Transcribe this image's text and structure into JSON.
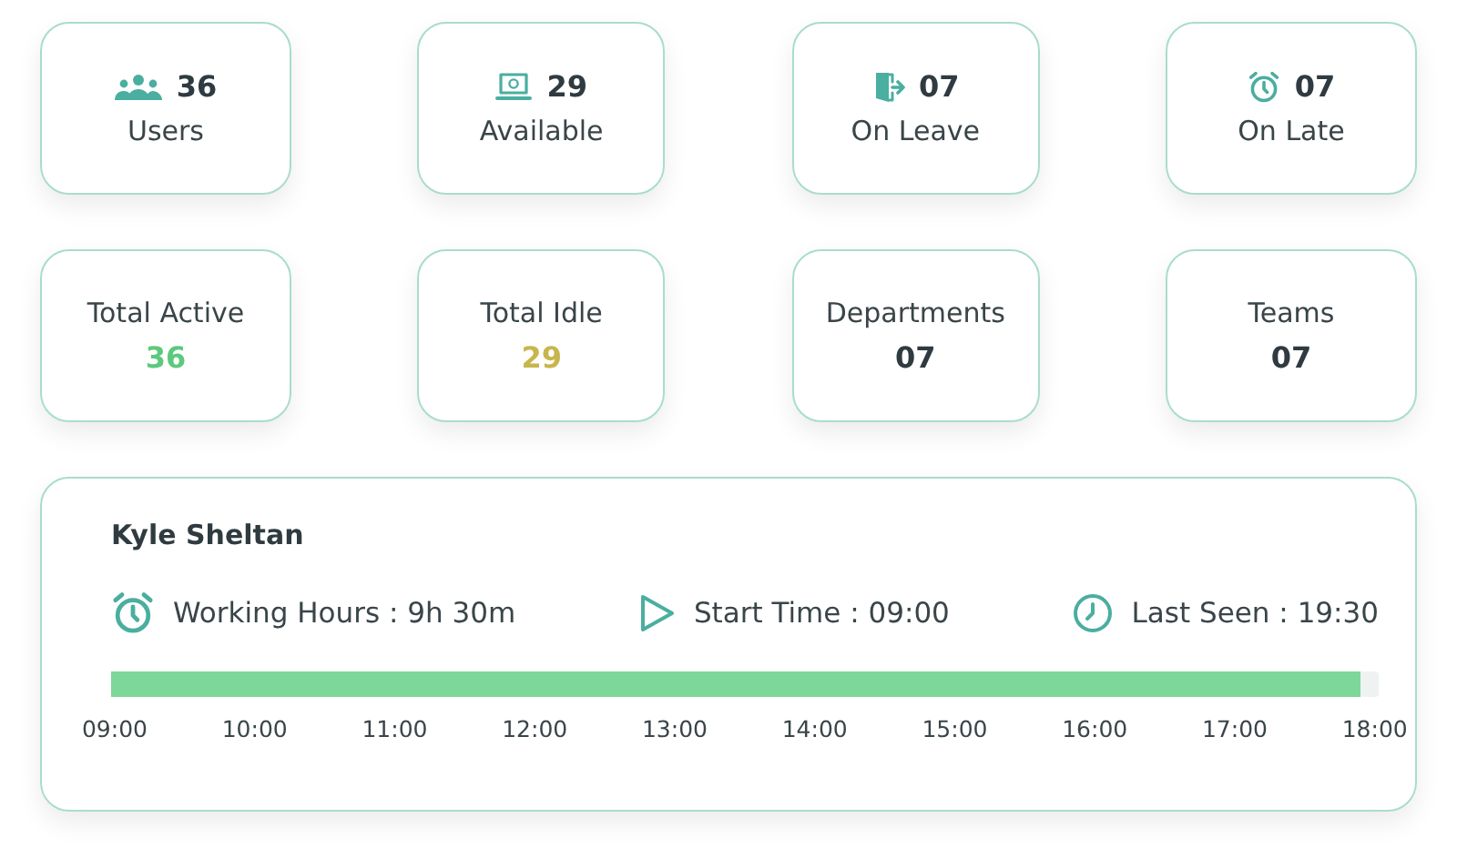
{
  "summary_cards": [
    {
      "kind": "users",
      "value": "36",
      "label": "Users"
    },
    {
      "kind": "laptop",
      "value": "29",
      "label": "Available"
    },
    {
      "kind": "exit",
      "value": "07",
      "label": "On Leave"
    },
    {
      "kind": "alarm",
      "value": "07",
      "label": "On Late"
    }
  ],
  "stat_cards": [
    {
      "label": "Total Active",
      "value": "36",
      "color": "#5cc97c"
    },
    {
      "label": "Total Idle",
      "value": "29",
      "color": "#c8b64c"
    },
    {
      "label": "Departments",
      "value": "07",
      "color": "#2f3b40"
    },
    {
      "label": "Teams",
      "value": "07",
      "color": "#2f3b40"
    }
  ],
  "timeline": {
    "name": "Kyle Sheltan",
    "metrics": [
      {
        "kind": "alarm",
        "text": "Working Hours : 9h 30m"
      },
      {
        "kind": "play",
        "text": "Start Time : 09:00"
      },
      {
        "kind": "clock",
        "text": "Last Seen : 19:30"
      }
    ],
    "level": 0.986,
    "ticks": [
      "09:00",
      "10:00",
      "11:00",
      "12:00",
      "13:00",
      "14:00",
      "15:00",
      "16:00",
      "17:00",
      "18:00"
    ]
  }
}
